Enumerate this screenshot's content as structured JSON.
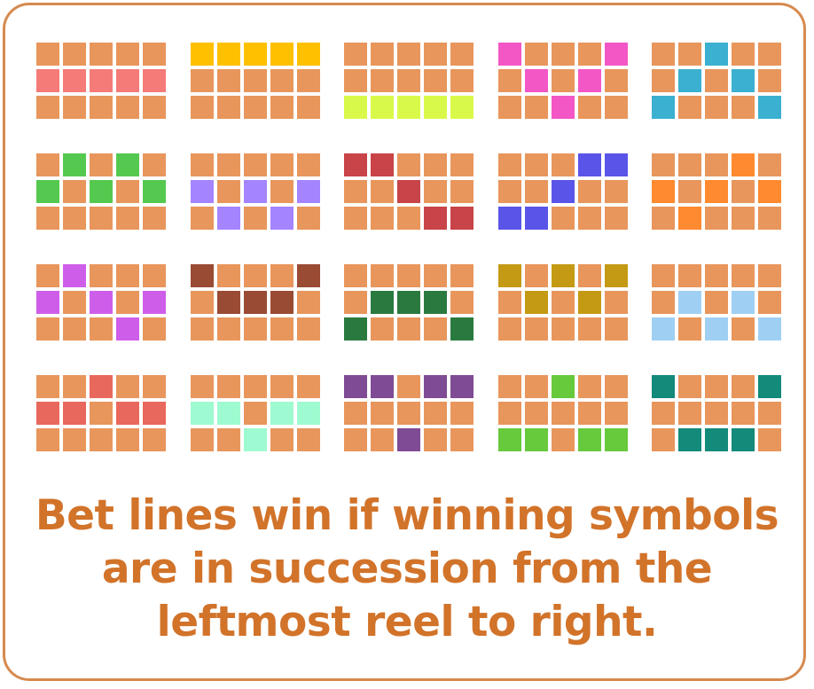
{
  "paytable": {
    "base_color": "#E8965C",
    "border_color": "#D68A4E",
    "lines": [
      {
        "color": "#F47B78",
        "rows": [
          1,
          1,
          1,
          1,
          1
        ]
      },
      {
        "color": "#FFC000",
        "rows": [
          0,
          0,
          0,
          0,
          0
        ]
      },
      {
        "color": "#D9F94A",
        "rows": [
          2,
          2,
          2,
          2,
          2
        ]
      },
      {
        "color": "#F357C6",
        "rows": [
          0,
          1,
          2,
          1,
          0
        ]
      },
      {
        "color": "#3BB0D0",
        "rows": [
          2,
          1,
          0,
          1,
          2
        ]
      },
      {
        "color": "#55C94F",
        "rows": [
          1,
          0,
          1,
          0,
          1
        ]
      },
      {
        "color": "#A584FF",
        "rows": [
          1,
          2,
          1,
          2,
          1
        ]
      },
      {
        "color": "#C84448",
        "rows": [
          0,
          0,
          1,
          2,
          2
        ]
      },
      {
        "color": "#5A55E8",
        "rows": [
          2,
          2,
          1,
          0,
          0
        ]
      },
      {
        "color": "#FF8A2F",
        "rows": [
          1,
          2,
          1,
          0,
          1
        ]
      },
      {
        "color": "#CE5EEA",
        "rows": [
          1,
          0,
          1,
          2,
          1
        ]
      },
      {
        "color": "#994B33",
        "rows": [
          0,
          1,
          1,
          1,
          0
        ]
      },
      {
        "color": "#2A7A40",
        "rows": [
          2,
          1,
          1,
          1,
          2
        ]
      },
      {
        "color": "#C49A14",
        "rows": [
          0,
          1,
          0,
          1,
          0
        ]
      },
      {
        "color": "#9FD0F4",
        "rows": [
          2,
          1,
          2,
          1,
          2
        ]
      },
      {
        "color": "#E9685D",
        "rows": [
          1,
          1,
          0,
          1,
          1
        ]
      },
      {
        "color": "#9EFAD0",
        "rows": [
          1,
          1,
          2,
          1,
          1
        ]
      },
      {
        "color": "#7F4B94",
        "rows": [
          0,
          0,
          2,
          0,
          0
        ]
      },
      {
        "color": "#67C93C",
        "rows": [
          2,
          2,
          0,
          2,
          2
        ]
      },
      {
        "color": "#138A7A",
        "rows": [
          0,
          2,
          2,
          2,
          0
        ]
      }
    ]
  },
  "caption": {
    "line1": "Bet lines win if winning symbols",
    "line2": "are in succession from the",
    "line3": "leftmost reel to right."
  }
}
